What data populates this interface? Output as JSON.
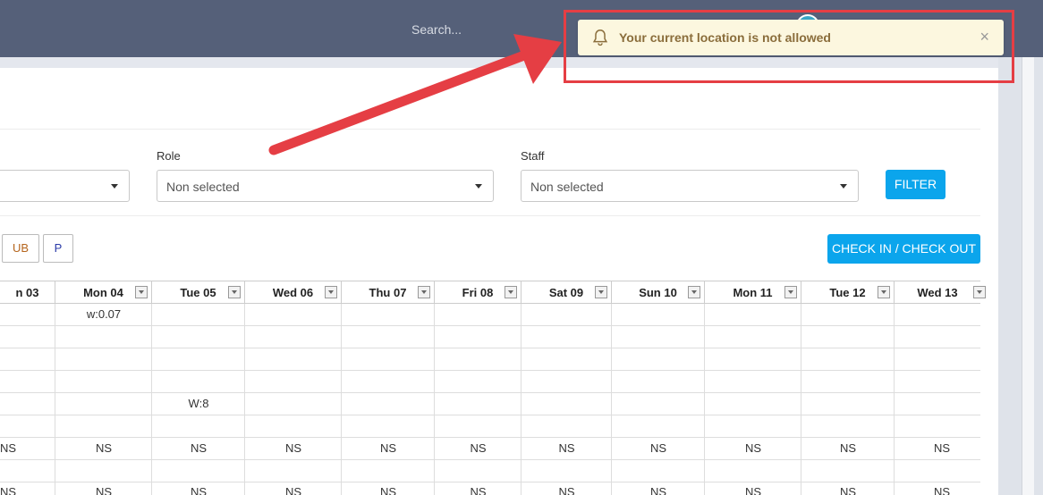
{
  "topbar": {
    "search_placeholder": "Search..."
  },
  "toast": {
    "message": "Your current location is not allowed",
    "close": "×"
  },
  "filters": {
    "role_label": "Role",
    "role_value": "Non selected",
    "staff_label": "Staff",
    "staff_value": "Non selected",
    "filter_button": "FILTER"
  },
  "chips": [
    {
      "label": "UB",
      "color": "#b5651d"
    },
    {
      "label": "P",
      "color": "#2a3aa8"
    }
  ],
  "checkin_button": "CHECK IN / CHECK OUT",
  "columns": [
    "n 03",
    "Mon 04",
    "Tue 05",
    "Wed 06",
    "Thu 07",
    "Fri 08",
    "Sat 09",
    "Sun 10",
    "Mon 11",
    "Tue 12",
    "Wed 13"
  ],
  "cells": {
    "mon04_row1": "w:0.07",
    "tue05_row5": "W:8",
    "ns": "NS"
  },
  "colors": {
    "topbar": "#556079",
    "accent": "#0ba5ec",
    "highlight": "#e53e44",
    "toast_bg": "#fcf7df"
  }
}
